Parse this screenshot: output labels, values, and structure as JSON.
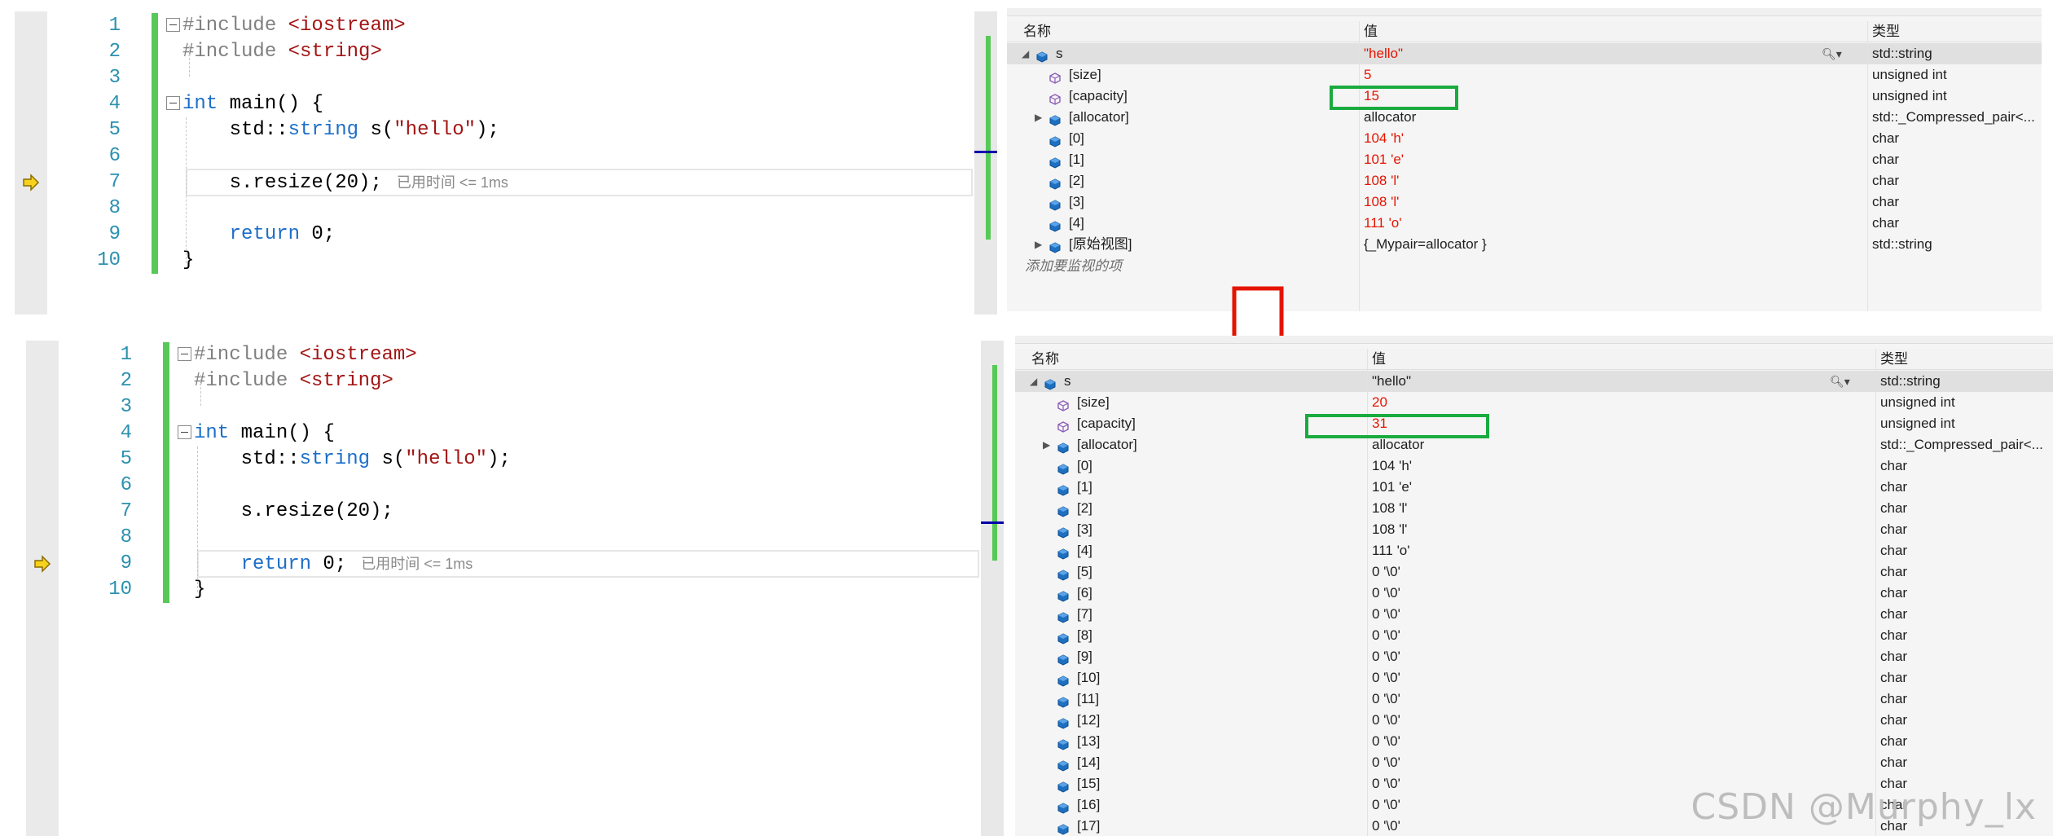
{
  "top_editor": {
    "lines": [
      {
        "n": "1",
        "parts": [
          {
            "t": "#include ",
            "c": "g"
          },
          {
            "t": "<iostream>",
            "c": "s"
          }
        ]
      },
      {
        "n": "2",
        "parts": [
          {
            "t": "#include ",
            "c": "g"
          },
          {
            "t": "<string>",
            "c": "s"
          }
        ]
      },
      {
        "n": "3",
        "parts": []
      },
      {
        "n": "4",
        "parts": [
          {
            "t": "int",
            "c": "k"
          },
          {
            "t": " main() {",
            "c": "t"
          }
        ]
      },
      {
        "n": "5",
        "parts": [
          {
            "t": "    std::",
            "c": "t"
          },
          {
            "t": "string",
            "c": "k"
          },
          {
            "t": " s(",
            "c": "t"
          },
          {
            "t": "\"hello\"",
            "c": "s"
          },
          {
            "t": ");",
            "c": "t"
          }
        ]
      },
      {
        "n": "6",
        "parts": []
      },
      {
        "n": "7",
        "parts": [
          {
            "t": "    s.resize(20);",
            "c": "t"
          }
        ],
        "hint": "已用时间 <= 1ms"
      },
      {
        "n": "8",
        "parts": []
      },
      {
        "n": "9",
        "parts": [
          {
            "t": "    ",
            "c": "t"
          },
          {
            "t": "return",
            "c": "k"
          },
          {
            "t": " 0;",
            "c": "t"
          }
        ]
      },
      {
        "n": "10",
        "parts": [
          {
            "t": "}",
            "c": "t"
          }
        ]
      }
    ]
  },
  "bottom_editor": {
    "lines": [
      {
        "n": "1",
        "parts": [
          {
            "t": "#include ",
            "c": "g"
          },
          {
            "t": "<iostream>",
            "c": "s"
          }
        ]
      },
      {
        "n": "2",
        "parts": [
          {
            "t": "#include ",
            "c": "g"
          },
          {
            "t": "<string>",
            "c": "s"
          }
        ]
      },
      {
        "n": "3",
        "parts": []
      },
      {
        "n": "4",
        "parts": [
          {
            "t": "int",
            "c": "k"
          },
          {
            "t": " main() {",
            "c": "t"
          }
        ]
      },
      {
        "n": "5",
        "parts": [
          {
            "t": "    std::",
            "c": "t"
          },
          {
            "t": "string",
            "c": "k"
          },
          {
            "t": " s(",
            "c": "t"
          },
          {
            "t": "\"hello\"",
            "c": "s"
          },
          {
            "t": ");",
            "c": "t"
          }
        ]
      },
      {
        "n": "6",
        "parts": []
      },
      {
        "n": "7",
        "parts": [
          {
            "t": "    s.resize(20);",
            "c": "t"
          }
        ]
      },
      {
        "n": "8",
        "parts": []
      },
      {
        "n": "9",
        "parts": [
          {
            "t": "    ",
            "c": "t"
          },
          {
            "t": "return",
            "c": "k"
          },
          {
            "t": " 0;",
            "c": "t"
          }
        ],
        "hint": "已用时间 <= 1ms"
      },
      {
        "n": "10",
        "parts": [
          {
            "t": "}",
            "c": "t"
          }
        ]
      }
    ]
  },
  "top_watch": {
    "headers": {
      "name": "名称",
      "value": "值",
      "type": "类型"
    },
    "rows": [
      {
        "indent": 0,
        "exp": "down",
        "ico": "var",
        "name": "s",
        "value": "\"hello\"",
        "type": "std::string",
        "red": true,
        "sel": true,
        "search": true
      },
      {
        "indent": 1,
        "exp": "",
        "ico": "prop",
        "name": "[size]",
        "value": "5",
        "type": "unsigned int",
        "red": true
      },
      {
        "indent": 1,
        "exp": "",
        "ico": "prop",
        "name": "[capacity]",
        "value": "15",
        "type": "unsigned int",
        "red": true
      },
      {
        "indent": 1,
        "exp": "right",
        "ico": "var",
        "name": "[allocator]",
        "value": "allocator",
        "type": "std::_Compressed_pair<...",
        "red": false
      },
      {
        "indent": 1,
        "exp": "",
        "ico": "var",
        "name": "[0]",
        "value": "104 'h'",
        "type": "char",
        "red": true
      },
      {
        "indent": 1,
        "exp": "",
        "ico": "var",
        "name": "[1]",
        "value": "101 'e'",
        "type": "char",
        "red": true
      },
      {
        "indent": 1,
        "exp": "",
        "ico": "var",
        "name": "[2]",
        "value": "108 'l'",
        "type": "char",
        "red": true
      },
      {
        "indent": 1,
        "exp": "",
        "ico": "var",
        "name": "[3]",
        "value": "108 'l'",
        "type": "char",
        "red": true
      },
      {
        "indent": 1,
        "exp": "",
        "ico": "var",
        "name": "[4]",
        "value": "111 'o'",
        "type": "char",
        "red": true
      },
      {
        "indent": 1,
        "exp": "right",
        "ico": "var",
        "name": "[原始视图]",
        "value": "{_Mypair=allocator }",
        "type": "std::string",
        "red": false
      }
    ],
    "add_text": "添加要监视的项"
  },
  "bottom_watch": {
    "headers": {
      "name": "名称",
      "value": "值",
      "type": "类型"
    },
    "rows": [
      {
        "indent": 0,
        "exp": "down",
        "ico": "var",
        "name": "s",
        "value": "\"hello\"",
        "type": "std::string",
        "red": false,
        "sel": true,
        "search": true
      },
      {
        "indent": 1,
        "exp": "",
        "ico": "prop",
        "name": "[size]",
        "value": "20",
        "type": "unsigned int",
        "red": true
      },
      {
        "indent": 1,
        "exp": "",
        "ico": "prop",
        "name": "[capacity]",
        "value": "31",
        "type": "unsigned int",
        "red": true
      },
      {
        "indent": 1,
        "exp": "right",
        "ico": "var",
        "name": "[allocator]",
        "value": "allocator",
        "type": "std::_Compressed_pair<...",
        "red": false
      },
      {
        "indent": 1,
        "exp": "",
        "ico": "var",
        "name": "[0]",
        "value": "104 'h'",
        "type": "char",
        "red": false
      },
      {
        "indent": 1,
        "exp": "",
        "ico": "var",
        "name": "[1]",
        "value": "101 'e'",
        "type": "char",
        "red": false
      },
      {
        "indent": 1,
        "exp": "",
        "ico": "var",
        "name": "[2]",
        "value": "108 'l'",
        "type": "char",
        "red": false
      },
      {
        "indent": 1,
        "exp": "",
        "ico": "var",
        "name": "[3]",
        "value": "108 'l'",
        "type": "char",
        "red": false
      },
      {
        "indent": 1,
        "exp": "",
        "ico": "var",
        "name": "[4]",
        "value": "111 'o'",
        "type": "char",
        "red": false
      },
      {
        "indent": 1,
        "exp": "",
        "ico": "var",
        "name": "[5]",
        "value": "0 '\\0'",
        "type": "char",
        "red": false
      },
      {
        "indent": 1,
        "exp": "",
        "ico": "var",
        "name": "[6]",
        "value": "0 '\\0'",
        "type": "char",
        "red": false
      },
      {
        "indent": 1,
        "exp": "",
        "ico": "var",
        "name": "[7]",
        "value": "0 '\\0'",
        "type": "char",
        "red": false
      },
      {
        "indent": 1,
        "exp": "",
        "ico": "var",
        "name": "[8]",
        "value": "0 '\\0'",
        "type": "char",
        "red": false
      },
      {
        "indent": 1,
        "exp": "",
        "ico": "var",
        "name": "[9]",
        "value": "0 '\\0'",
        "type": "char",
        "red": false
      },
      {
        "indent": 1,
        "exp": "",
        "ico": "var",
        "name": "[10]",
        "value": "0 '\\0'",
        "type": "char",
        "red": false
      },
      {
        "indent": 1,
        "exp": "",
        "ico": "var",
        "name": "[11]",
        "value": "0 '\\0'",
        "type": "char",
        "red": false
      },
      {
        "indent": 1,
        "exp": "",
        "ico": "var",
        "name": "[12]",
        "value": "0 '\\0'",
        "type": "char",
        "red": false
      },
      {
        "indent": 1,
        "exp": "",
        "ico": "var",
        "name": "[13]",
        "value": "0 '\\0'",
        "type": "char",
        "red": false
      },
      {
        "indent": 1,
        "exp": "",
        "ico": "var",
        "name": "[14]",
        "value": "0 '\\0'",
        "type": "char",
        "red": false
      },
      {
        "indent": 1,
        "exp": "",
        "ico": "var",
        "name": "[15]",
        "value": "0 '\\0'",
        "type": "char",
        "red": false
      },
      {
        "indent": 1,
        "exp": "",
        "ico": "var",
        "name": "[16]",
        "value": "0 '\\0'",
        "type": "char",
        "red": false
      },
      {
        "indent": 1,
        "exp": "",
        "ico": "var",
        "name": "[17]",
        "value": "0 '\\0'",
        "type": "char",
        "red": false
      }
    ]
  },
  "colors": {
    "accent_green": "#1aab3f",
    "arrow_red": "#e51400",
    "changed_red": "#e51400"
  },
  "icons": {
    "current_statement": "current-statement-arrow-icon",
    "variable": "variable-cube-icon",
    "property": "property-icon"
  },
  "watermark": "CSDN @Murphy_lx"
}
